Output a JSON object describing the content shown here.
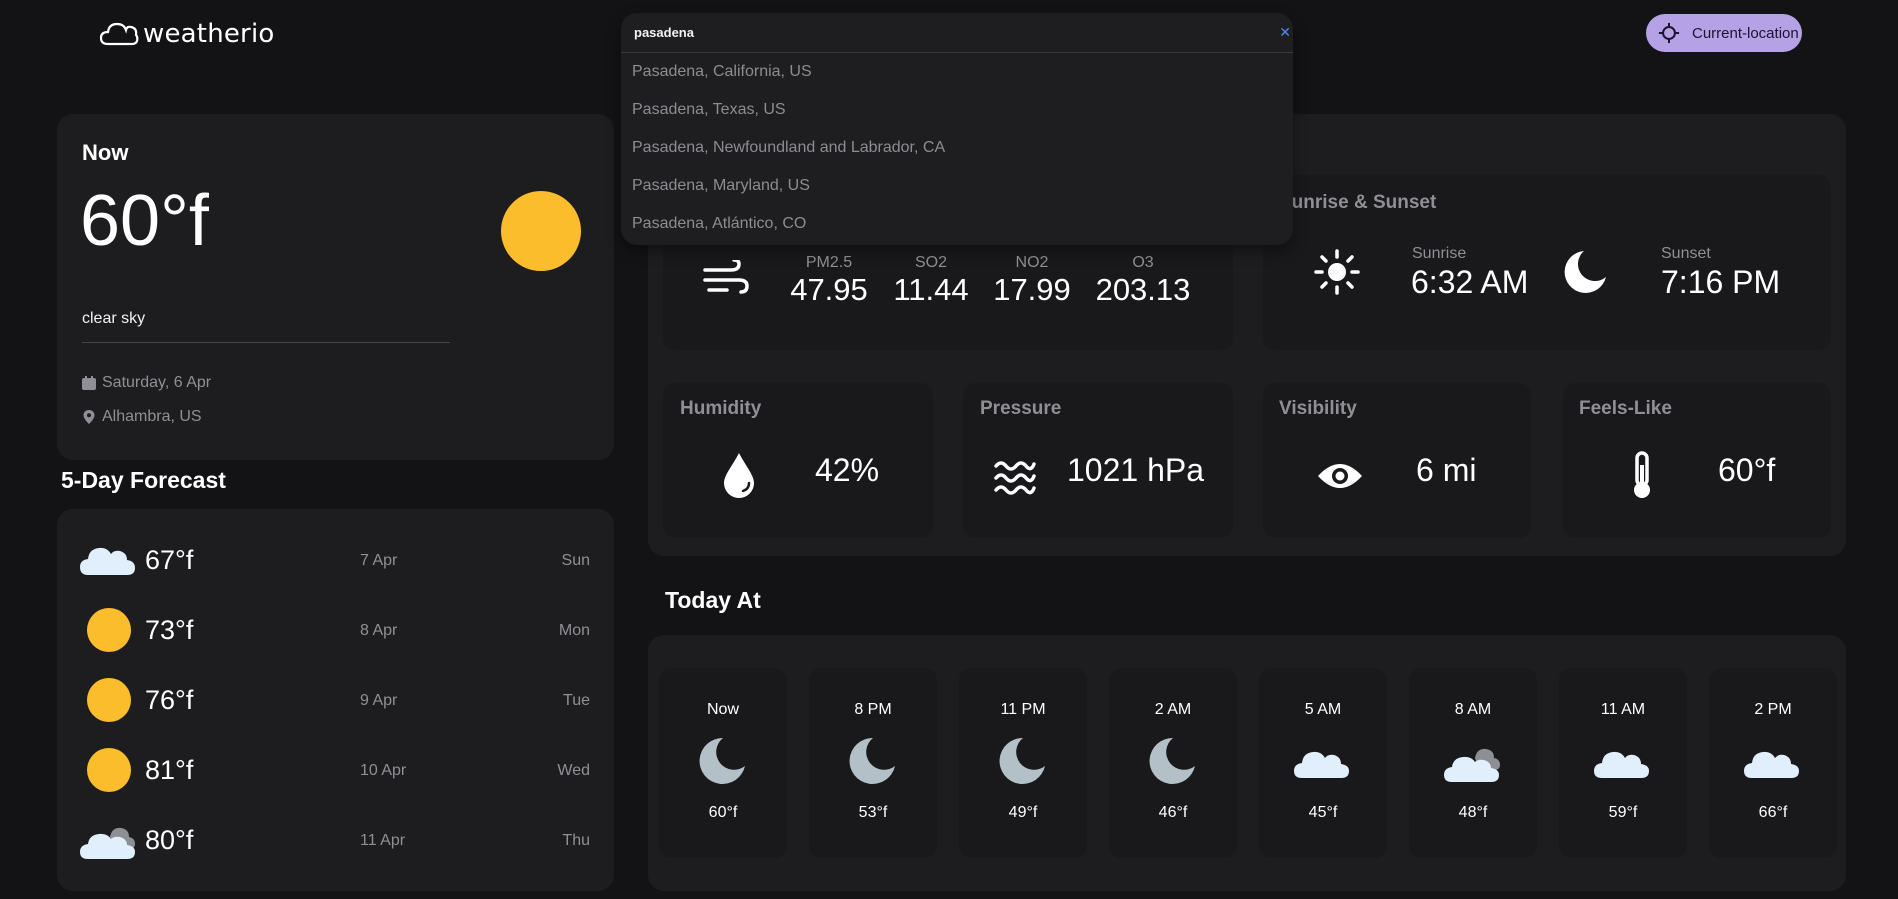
{
  "app": {
    "name": "weatherio"
  },
  "header": {
    "location_button": "Current-location"
  },
  "search": {
    "value": "pasadena",
    "clear_icon": "close-icon",
    "suggestions": [
      "Pasadena, California, US",
      "Pasadena, Texas, US",
      "Pasadena, Newfoundland and Labrador, CA",
      "Pasadena, Maryland, US",
      "Pasadena, Atlántico, CO"
    ]
  },
  "current": {
    "title": "Now",
    "temp": "60°f",
    "description": "clear sky",
    "date": "Saturday, 6 Apr",
    "location": "Alhambra, US",
    "icon": "sun-icon"
  },
  "forecast": {
    "title": "5-Day Forecast",
    "days": [
      {
        "icon": "cloud-icon",
        "temp": "67°f",
        "date": "7 Apr",
        "day": "Sun"
      },
      {
        "icon": "sun-icon",
        "temp": "73°f",
        "date": "8 Apr",
        "day": "Mon"
      },
      {
        "icon": "sun-icon",
        "temp": "76°f",
        "date": "9 Apr",
        "day": "Tue"
      },
      {
        "icon": "sun-icon",
        "temp": "81°f",
        "date": "10 Apr",
        "day": "Wed"
      },
      {
        "icon": "broken-clouds-icon",
        "temp": "80°f",
        "date": "11 Apr",
        "day": "Thu"
      }
    ]
  },
  "highlights": {
    "air_quality": {
      "items": [
        {
          "label": "PM2.5",
          "value": "47.95"
        },
        {
          "label": "SO2",
          "value": "11.44"
        },
        {
          "label": "NO2",
          "value": "17.99"
        },
        {
          "label": "O3",
          "value": "203.13"
        }
      ]
    },
    "sun": {
      "title": "Sunrise & Sunset",
      "sunrise_label": "Sunrise",
      "sunrise": "6:32 AM",
      "sunset_label": "Sunset",
      "sunset": "7:16 PM"
    },
    "humidity": {
      "label": "Humidity",
      "value": "42%"
    },
    "pressure": {
      "label": "Pressure",
      "value": "1021 hPa"
    },
    "visibility": {
      "label": "Visibility",
      "value": "6 mi"
    },
    "feels_like": {
      "label": "Feels-Like",
      "value": "60°f"
    }
  },
  "today": {
    "title": "Today At",
    "hours": [
      {
        "time": "Now",
        "icon": "moon-icon",
        "temp": "60°f"
      },
      {
        "time": "8 PM",
        "icon": "moon-icon",
        "temp": "53°f"
      },
      {
        "time": "11 PM",
        "icon": "moon-icon",
        "temp": "49°f"
      },
      {
        "time": "2 AM",
        "icon": "moon-icon",
        "temp": "46°f"
      },
      {
        "time": "5 AM",
        "icon": "cloud-icon",
        "temp": "45°f"
      },
      {
        "time": "8 AM",
        "icon": "broken-clouds-icon",
        "temp": "48°f"
      },
      {
        "time": "11 AM",
        "icon": "cloud-icon",
        "temp": "59°f"
      },
      {
        "time": "2 PM",
        "icon": "cloud-icon",
        "temp": "66°f"
      }
    ]
  },
  "colors": {
    "accent": "#b5a1e5",
    "sun": "#fcbd2d",
    "card": "#1d1d1f",
    "background": "#131315"
  }
}
